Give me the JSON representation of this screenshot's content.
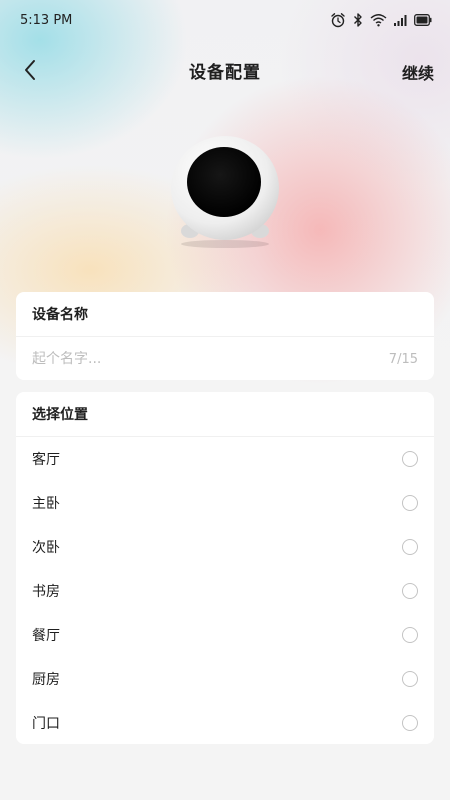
{
  "status_bar": {
    "time": "5:13 PM",
    "icons": [
      "alarm-icon",
      "bluetooth-icon",
      "wifi-icon",
      "signal-icon",
      "battery-icon"
    ]
  },
  "nav": {
    "back_icon": "chevron-left-icon",
    "title": "设备配置",
    "continue_label": "继续"
  },
  "device_name": {
    "header": "设备名称",
    "placeholder": "起个名字...",
    "value": "",
    "counter": "7/15"
  },
  "location": {
    "header": "选择位置",
    "options": [
      {
        "label": "客厅",
        "selected": false
      },
      {
        "label": "主卧",
        "selected": false
      },
      {
        "label": "次卧",
        "selected": false
      },
      {
        "label": "书房",
        "selected": false
      },
      {
        "label": "餐厅",
        "selected": false
      },
      {
        "label": "厨房",
        "selected": false
      },
      {
        "label": "门口",
        "selected": false
      }
    ]
  },
  "colors": {
    "page_background": "#f4f4f4",
    "card_background": "#ffffff",
    "primary_text": "#1f1f1f",
    "placeholder_text": "#bdbdbd",
    "radio_border": "#c4c4c4"
  }
}
